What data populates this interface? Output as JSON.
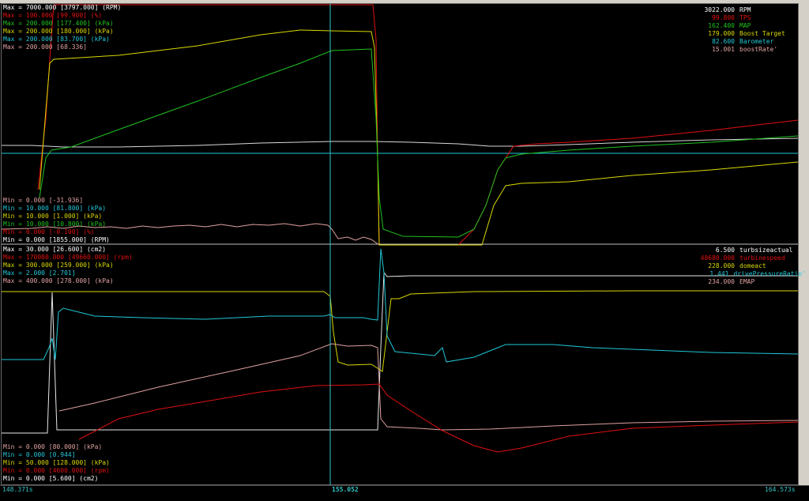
{
  "colors": {
    "white": "#e8e8e8",
    "red": "#e01010",
    "green": "#20c020",
    "yellow": "#d8d800",
    "cyan": "#20c8d8",
    "pink": "#e0a0a0",
    "cursor": "#34c6c9"
  },
  "top_panel": {
    "max_labels": [
      {
        "text": "Max = 7000.000 [3797.000] (RPM)",
        "color": "#ffffff"
      },
      {
        "text": "Max = 100.000 [99.900] (%)",
        "color": "#e01010"
      },
      {
        "text": "Max = 200.000 [177.400] (kPa)",
        "color": "#20c020"
      },
      {
        "text": "Max = 200.000 [180.000] (kPa)",
        "color": "#d8d800"
      },
      {
        "text": "Max = 200.000 [83.700] (kPa)",
        "color": "#20c8d8"
      },
      {
        "text": "Max = 200.000 [68.336]",
        "color": "#e0a0a0"
      }
    ],
    "min_labels": [
      {
        "text": "Min = 0.000 [-31.936]",
        "color": "#e0a0a0"
      },
      {
        "text": "Min = 10.000 [81.800] (kPa)",
        "color": "#20c8d8"
      },
      {
        "text": "Min = 10.000 [1.000] (kPa)",
        "color": "#d8d800"
      },
      {
        "text": "Min = 10.000 [10.800] (kPa)",
        "color": "#20c020"
      },
      {
        "text": "Min = 0.000 [-0.100] (%)",
        "color": "#e01010"
      },
      {
        "text": "Min = 0.000 [1855.000] (RPM)",
        "color": "#ffffff"
      }
    ],
    "legend": [
      {
        "value": "3022.000",
        "name": "RPM",
        "color": "#ffffff"
      },
      {
        "value": "99.800",
        "name": "TPS",
        "color": "#e01010"
      },
      {
        "value": "162.400",
        "name": "MAP",
        "color": "#20c020"
      },
      {
        "value": "179.000",
        "name": "Boost Target",
        "color": "#d8d800"
      },
      {
        "value": "82.600",
        "name": "Barometer",
        "color": "#20c8d8"
      },
      {
        "value": "15.001",
        "name": "boostRate'",
        "color": "#e0a0a0"
      }
    ]
  },
  "bottom_panel": {
    "max_labels": [
      {
        "text": "Max = 30.000 [26.600] (cm2)",
        "color": "#ffffff"
      },
      {
        "text": "Max = 170000.000 [49660.000] (rpm)",
        "color": "#e01010"
      },
      {
        "text": "Max = 300.000 [259.000] (kPa)",
        "color": "#d8d800"
      },
      {
        "text": "Max = 2.000 [2.701]",
        "color": "#20c8d8"
      },
      {
        "text": "Max = 400.000 [278.000] (kPa)",
        "color": "#e0a0a0"
      }
    ],
    "min_labels": [
      {
        "text": "Min = 0.000 [80.000] (kPa)",
        "color": "#e0a0a0"
      },
      {
        "text": "Min = 0.000 [0.944]",
        "color": "#20c8d8"
      },
      {
        "text": "Min = 50.000 [128.000] (kPa)",
        "color": "#d8d800"
      },
      {
        "text": "Min = 0.000 [4600.000] (rpm)",
        "color": "#e01010"
      },
      {
        "text": "Min = 0.000 [5.600] (cm2)",
        "color": "#ffffff"
      }
    ],
    "legend": [
      {
        "value": "6.500",
        "name": "turbsizeactual",
        "color": "#ffffff"
      },
      {
        "value": "48680.000",
        "name": "turbinespeed",
        "color": "#e01010"
      },
      {
        "value": "228.000",
        "name": "domeact",
        "color": "#d8d800"
      },
      {
        "value": "1.441",
        "name": "drivePressureRatio'",
        "color": "#20c8d8"
      },
      {
        "value": "234.000",
        "name": "EMAP",
        "color": "#e0a0a0"
      }
    ]
  },
  "time_axis": {
    "start": "148.371s",
    "cursor": "155.052",
    "end": "164.573s"
  }
}
